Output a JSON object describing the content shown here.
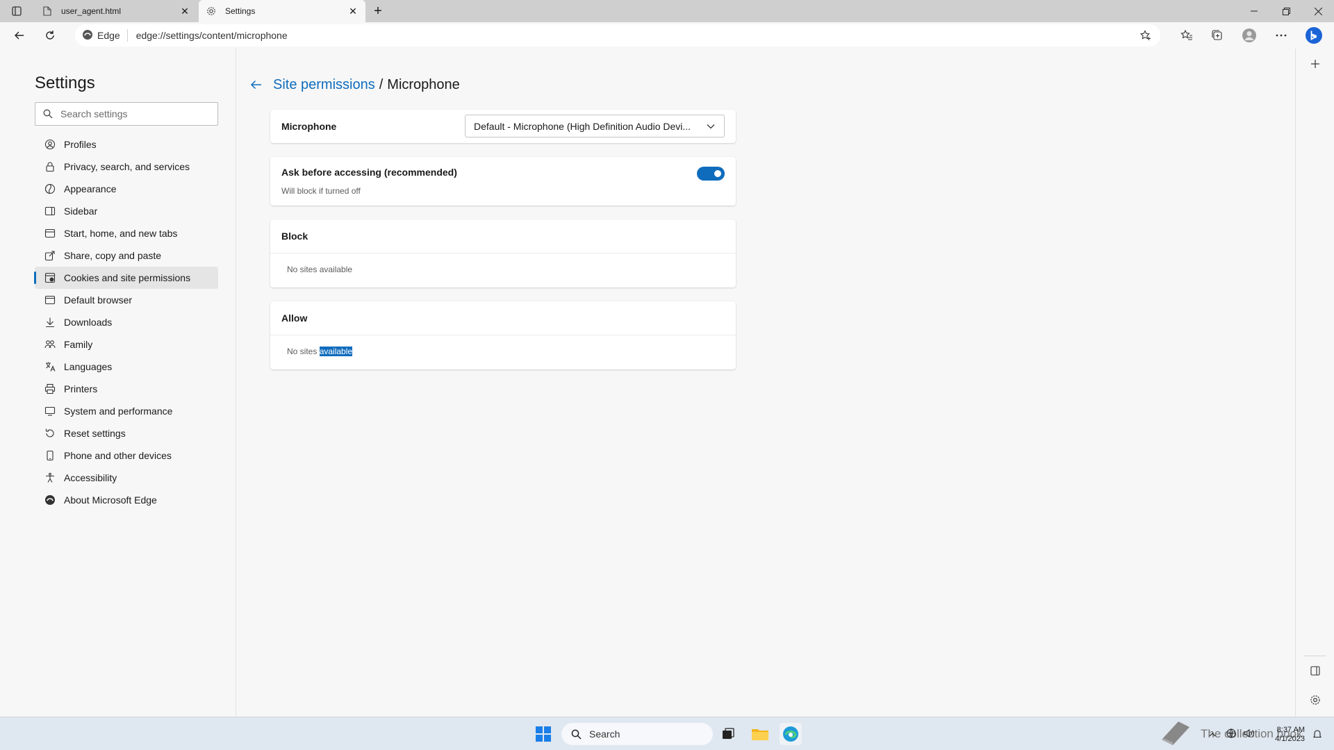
{
  "browser": {
    "tabs": [
      {
        "title": "user_agent.html",
        "icon": "file-icon",
        "active": false
      },
      {
        "title": "Settings",
        "icon": "gear-icon",
        "active": true
      }
    ],
    "address": {
      "chip_label": "Edge",
      "url": "edge://settings/content/microphone"
    }
  },
  "settings": {
    "title": "Settings",
    "search_placeholder": "Search settings",
    "nav": [
      {
        "label": "Profiles",
        "icon": "profile-icon"
      },
      {
        "label": "Privacy, search, and services",
        "icon": "lock-icon"
      },
      {
        "label": "Appearance",
        "icon": "appearance-icon"
      },
      {
        "label": "Sidebar",
        "icon": "sidebar-icon"
      },
      {
        "label": "Start, home, and new tabs",
        "icon": "home-icon"
      },
      {
        "label": "Share, copy and paste",
        "icon": "share-icon"
      },
      {
        "label": "Cookies and site permissions",
        "icon": "cookies-icon",
        "selected": true
      },
      {
        "label": "Default browser",
        "icon": "browser-icon"
      },
      {
        "label": "Downloads",
        "icon": "download-icon"
      },
      {
        "label": "Family",
        "icon": "family-icon"
      },
      {
        "label": "Languages",
        "icon": "language-icon"
      },
      {
        "label": "Printers",
        "icon": "printer-icon"
      },
      {
        "label": "System and performance",
        "icon": "system-icon"
      },
      {
        "label": "Reset settings",
        "icon": "reset-icon"
      },
      {
        "label": "Phone and other devices",
        "icon": "phone-icon"
      },
      {
        "label": "Accessibility",
        "icon": "accessibility-icon"
      },
      {
        "label": "About Microsoft Edge",
        "icon": "edge-icon"
      }
    ]
  },
  "page": {
    "breadcrumb_parent": "Site permissions",
    "breadcrumb_separator": "/",
    "breadcrumb_current": "Microphone",
    "microphone_label": "Microphone",
    "microphone_device": "Default - Microphone (High Definition Audio Devi...",
    "ask_label": "Ask before accessing (recommended)",
    "ask_sublabel": "Will block if turned off",
    "ask_enabled": true,
    "block_title": "Block",
    "block_empty_prefix": "No sites",
    "block_empty_suffix": "available",
    "allow_title": "Allow",
    "allow_empty_prefix": "No sites",
    "allow_empty_selected": "available"
  },
  "taskbar": {
    "search_label": "Search",
    "time": "8:37 AM",
    "date": "4/1/2023",
    "watermark": "The collection book"
  },
  "colors": {
    "accent": "#0f6cbd",
    "selected_nav_bg": "#e5e5e5",
    "taskbar_bg": "#dfe7f0"
  }
}
